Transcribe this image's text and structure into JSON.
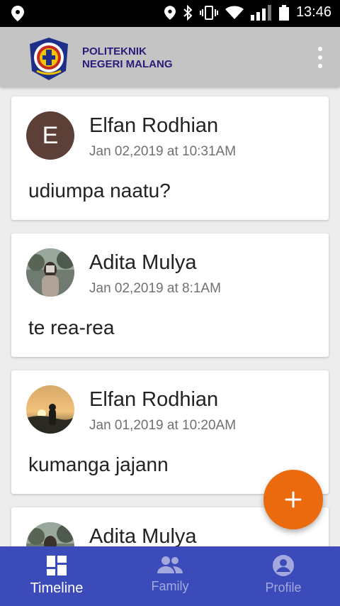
{
  "status_bar": {
    "time": "13:46"
  },
  "app_bar": {
    "title_line1": "POLITEKNIK",
    "title_line2": "NEGERI MALANG"
  },
  "posts": [
    {
      "name": "Elfan Rodhian",
      "date": "Jan 02,2019 at 10:31AM",
      "message": "udiumpa naatu?",
      "avatar_letter": "E",
      "avatar_color": "#5c3f36"
    },
    {
      "name": "Adita Mulya",
      "date": "Jan 02,2019 at 8:1AM",
      "message": "te rea-rea",
      "avatar_letter": "",
      "avatar_color": ""
    },
    {
      "name": "Elfan Rodhian",
      "date": "Jan 01,2019 at 10:20AM",
      "message": "kumanga jajann",
      "avatar_letter": "",
      "avatar_color": ""
    },
    {
      "name": "Adita Mulya",
      "date": "",
      "message": "",
      "avatar_letter": "",
      "avatar_color": ""
    }
  ],
  "fab": {
    "icon": "plus-icon",
    "color": "#ec6a0e"
  },
  "bottom_nav": {
    "background": "#3c4bba",
    "items": [
      {
        "label": "Timeline",
        "icon": "dashboard-icon",
        "active": true
      },
      {
        "label": "Family",
        "icon": "group-icon",
        "active": false
      },
      {
        "label": "Profile",
        "icon": "account-circle-icon",
        "active": false
      }
    ]
  }
}
